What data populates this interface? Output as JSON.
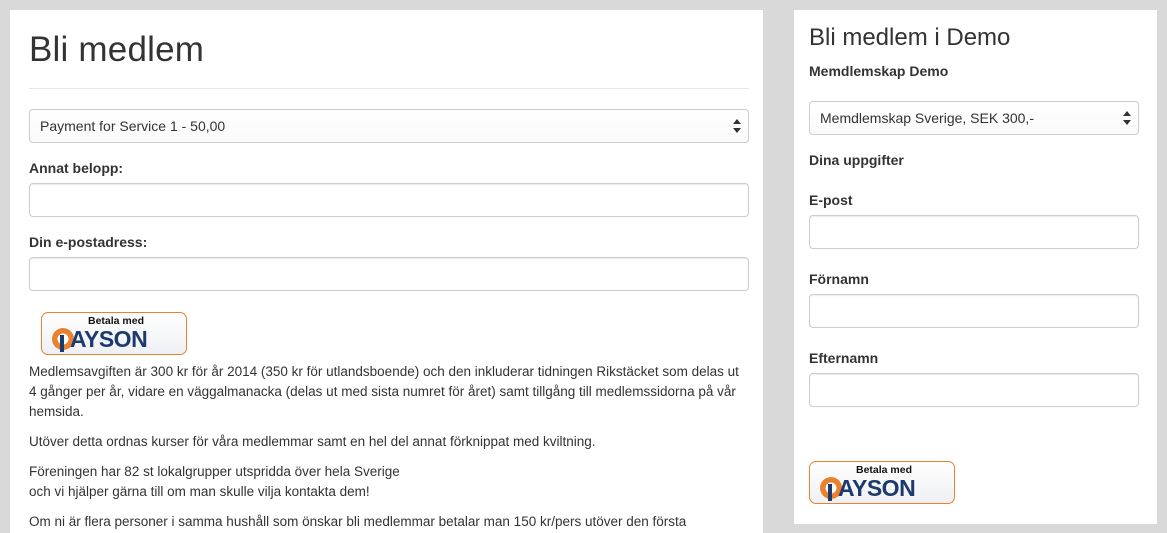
{
  "left": {
    "title": "Bli medlem",
    "payment_select": {
      "selected": "Payment for Service 1 - 50,00"
    },
    "other_amount_label": "Annat belopp:",
    "other_amount_value": "",
    "email_label": "Din e-postadress:",
    "email_value": "",
    "payson_button": {
      "top_text": "Betala med",
      "word": "AYSON"
    },
    "paragraphs": [
      "Medlemsavgiften är 300 kr för år 2014 (350 kr för utlandsboende) och den inkluderar tidningen Rikstäcket som delas ut 4 gånger per år, vidare en väggalmanacka (delas ut med sista numret för året) samt tillgång till medlemssidorna på vår hemsida.",
      "Utöver detta ordnas kurser för våra medlemmar samt en hel del annat förknippat med kviltning.",
      "Om ni är flera personer i samma hushåll som önskar bli medlemmar betalar man 150 kr/pers utöver den första"
    ],
    "local_groups_line1": "Föreningen har 82 st lokalgrupper utspridda över hela Sverige",
    "local_groups_line2": "och vi hjälper gärna till om man skulle vilja kontakta dem!"
  },
  "right": {
    "title": "Bli medlem i Demo",
    "membership_label": "Memdlemskap Demo",
    "membership_select": {
      "selected": "Memdlemskap Sverige, SEK 300,-"
    },
    "details_heading": "Dina uppgifter",
    "email_label": "E-post",
    "firstname_label": "Förnamn",
    "lastname_label": "Efternamn",
    "payson_button": {
      "top_text": "Betala med",
      "word": "AYSON"
    }
  },
  "colors": {
    "background": "#d9d9d9",
    "payson_orange": "#e8822e",
    "payson_blue": "#1d3a6e"
  }
}
